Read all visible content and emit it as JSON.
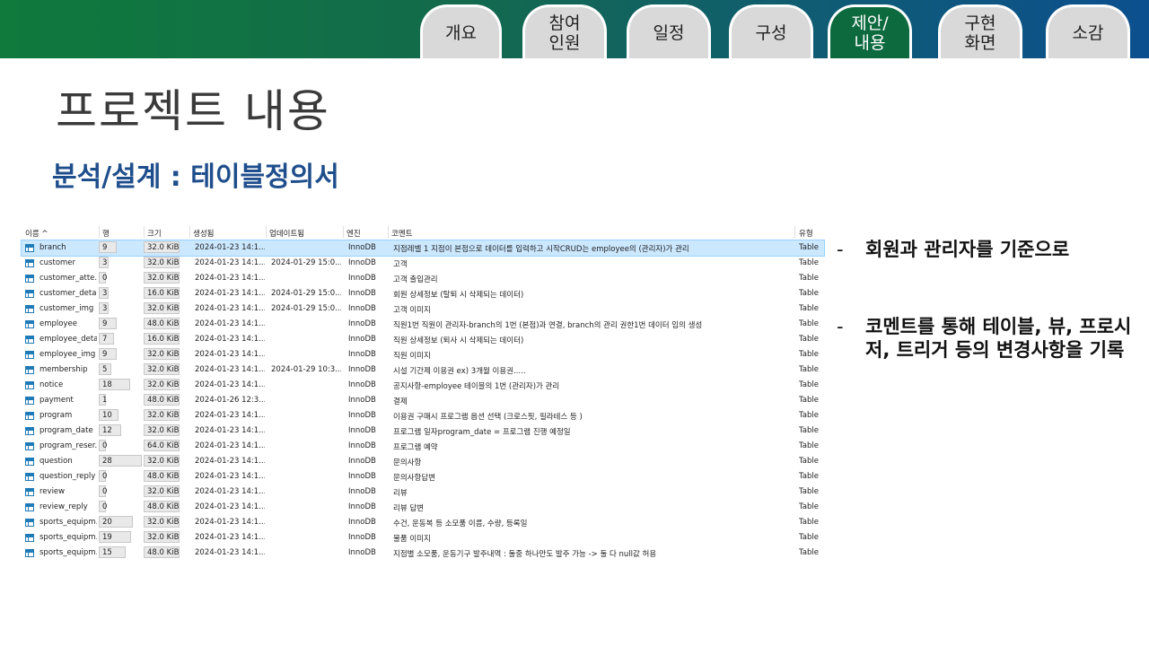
{
  "nav": {
    "tabs": [
      {
        "label": "개요",
        "active": false
      },
      {
        "label": "참여\n인원",
        "active": false
      },
      {
        "label": "일정",
        "active": false
      },
      {
        "label": "구성",
        "active": false
      },
      {
        "label": "제안/\n내용",
        "active": true
      },
      {
        "label": "구현\n화면",
        "active": false
      },
      {
        "label": "소감",
        "active": false
      }
    ]
  },
  "page_title": "프로젝트 내용",
  "subtitle": "분석/설계 : 테이블정의서",
  "table": {
    "columns": [
      "이름 ^",
      "행",
      "크기",
      "생성됨",
      "업데이트됨",
      "엔진",
      "코멘트",
      "유형"
    ],
    "rows": [
      {
        "name": "branch",
        "rows": "9",
        "size": "32.0 KiB",
        "created": "2024-01-23 14:1...",
        "updated": "",
        "engine": "InnoDB",
        "comment": "지점레벨 1 지점이 본점으로 데이터를 입력하고 시작CRUD는 employee의 (관리자)가 관리",
        "type": "Table",
        "selected": true
      },
      {
        "name": "customer",
        "rows": "3",
        "size": "32.0 KiB",
        "created": "2024-01-23 14:1...",
        "updated": "2024-01-29 15:0...",
        "engine": "InnoDB",
        "comment": "고객",
        "type": "Table"
      },
      {
        "name": "customer_atte...",
        "rows": "0",
        "size": "32.0 KiB",
        "created": "2024-01-23 14:1...",
        "updated": "",
        "engine": "InnoDB",
        "comment": "고객 출입관리",
        "type": "Table"
      },
      {
        "name": "customer_detail",
        "rows": "3",
        "size": "16.0 KiB",
        "created": "2024-01-23 14:1...",
        "updated": "2024-01-29 15:0...",
        "engine": "InnoDB",
        "comment": "회원 상세정보 (탈퇴 시 삭제되는 데이터)",
        "type": "Table"
      },
      {
        "name": "customer_img",
        "rows": "3",
        "size": "32.0 KiB",
        "created": "2024-01-23 14:1...",
        "updated": "2024-01-29 15:0...",
        "engine": "InnoDB",
        "comment": "고객 이미지",
        "type": "Table"
      },
      {
        "name": "employee",
        "rows": "9",
        "size": "48.0 KiB",
        "created": "2024-01-23 14:1...",
        "updated": "",
        "engine": "InnoDB",
        "comment": "직원1번 직원이 관리자-branch의 1번 (본점)과 연결, branch의 관리 권한1번 데이터 임의 생성",
        "type": "Table"
      },
      {
        "name": "employee_detail",
        "rows": "7",
        "size": "16.0 KiB",
        "created": "2024-01-23 14:1...",
        "updated": "",
        "engine": "InnoDB",
        "comment": "직원 상세정보 (퇴사 시 삭제되는 데이터)",
        "type": "Table"
      },
      {
        "name": "employee_img",
        "rows": "9",
        "size": "32.0 KiB",
        "created": "2024-01-23 14:1...",
        "updated": "",
        "engine": "InnoDB",
        "comment": "직원 이미지",
        "type": "Table"
      },
      {
        "name": "membership",
        "rows": "5",
        "size": "32.0 KiB",
        "created": "2024-01-23 14:1...",
        "updated": "2024-01-29 10:3...",
        "engine": "InnoDB",
        "comment": "시설 기간제 이용권 ex) 3개월 이용권.....",
        "type": "Table"
      },
      {
        "name": "notice",
        "rows": "18",
        "size": "32.0 KiB",
        "created": "2024-01-23 14:1...",
        "updated": "",
        "engine": "InnoDB",
        "comment": "공지사항-employee 테이블의 1번 (관리자)가 관리",
        "type": "Table"
      },
      {
        "name": "payment",
        "rows": "1",
        "size": "48.0 KiB",
        "created": "2024-01-26 12:3...",
        "updated": "",
        "engine": "InnoDB",
        "comment": "결제",
        "type": "Table"
      },
      {
        "name": "program",
        "rows": "10",
        "size": "32.0 KiB",
        "created": "2024-01-23 14:1...",
        "updated": "",
        "engine": "InnoDB",
        "comment": "이용권 구매시 프로그램 옵션 선택 (크로스핏, 필라테스 등 )",
        "type": "Table"
      },
      {
        "name": "program_date",
        "rows": "12",
        "size": "32.0 KiB",
        "created": "2024-01-23 14:1...",
        "updated": "",
        "engine": "InnoDB",
        "comment": "프로그램 일자program_date = 프로그램 진행 예정일",
        "type": "Table"
      },
      {
        "name": "program_reser...",
        "rows": "0",
        "size": "64.0 KiB",
        "created": "2024-01-23 14:1...",
        "updated": "",
        "engine": "InnoDB",
        "comment": "프로그램 예약",
        "type": "Table"
      },
      {
        "name": "question",
        "rows": "28",
        "size": "32.0 KiB",
        "created": "2024-01-23 14:1...",
        "updated": "",
        "engine": "InnoDB",
        "comment": "문의사항",
        "type": "Table"
      },
      {
        "name": "question_reply",
        "rows": "0",
        "size": "48.0 KiB",
        "created": "2024-01-23 14:1...",
        "updated": "",
        "engine": "InnoDB",
        "comment": "문의사항답변",
        "type": "Table"
      },
      {
        "name": "review",
        "rows": "0",
        "size": "32.0 KiB",
        "created": "2024-01-23 14:1...",
        "updated": "",
        "engine": "InnoDB",
        "comment": "리뷰",
        "type": "Table"
      },
      {
        "name": "review_reply",
        "rows": "0",
        "size": "48.0 KiB",
        "created": "2024-01-23 14:1...",
        "updated": "",
        "engine": "InnoDB",
        "comment": "리뷰 답변",
        "type": "Table"
      },
      {
        "name": "sports_equipm...",
        "rows": "20",
        "size": "32.0 KiB",
        "created": "2024-01-23 14:1...",
        "updated": "",
        "engine": "InnoDB",
        "comment": "수건, 운동복 등 소모품  이름, 수량, 등록일",
        "type": "Table"
      },
      {
        "name": "sports_equipm...",
        "rows": "19",
        "size": "32.0 KiB",
        "created": "2024-01-23 14:1...",
        "updated": "",
        "engine": "InnoDB",
        "comment": "물품 이미지",
        "type": "Table"
      },
      {
        "name": "sports_equipm...",
        "rows": "15",
        "size": "48.0 KiB",
        "created": "2024-01-23 14:1...",
        "updated": "",
        "engine": "InnoDB",
        "comment": "지점별 소모품, 운동기구 발주내역 : 둘중 하나만도 발주 가능 -> 둘 다 null값 허용",
        "type": "Table"
      }
    ]
  },
  "bullets": [
    {
      "dash": "-",
      "text": "회원과 관리자를 기준으로"
    },
    {
      "dash": "-",
      "text": "코멘트를 통해 테이블, 뷰, 프로시저, 트리거 등의 변경사항을 기록"
    }
  ]
}
